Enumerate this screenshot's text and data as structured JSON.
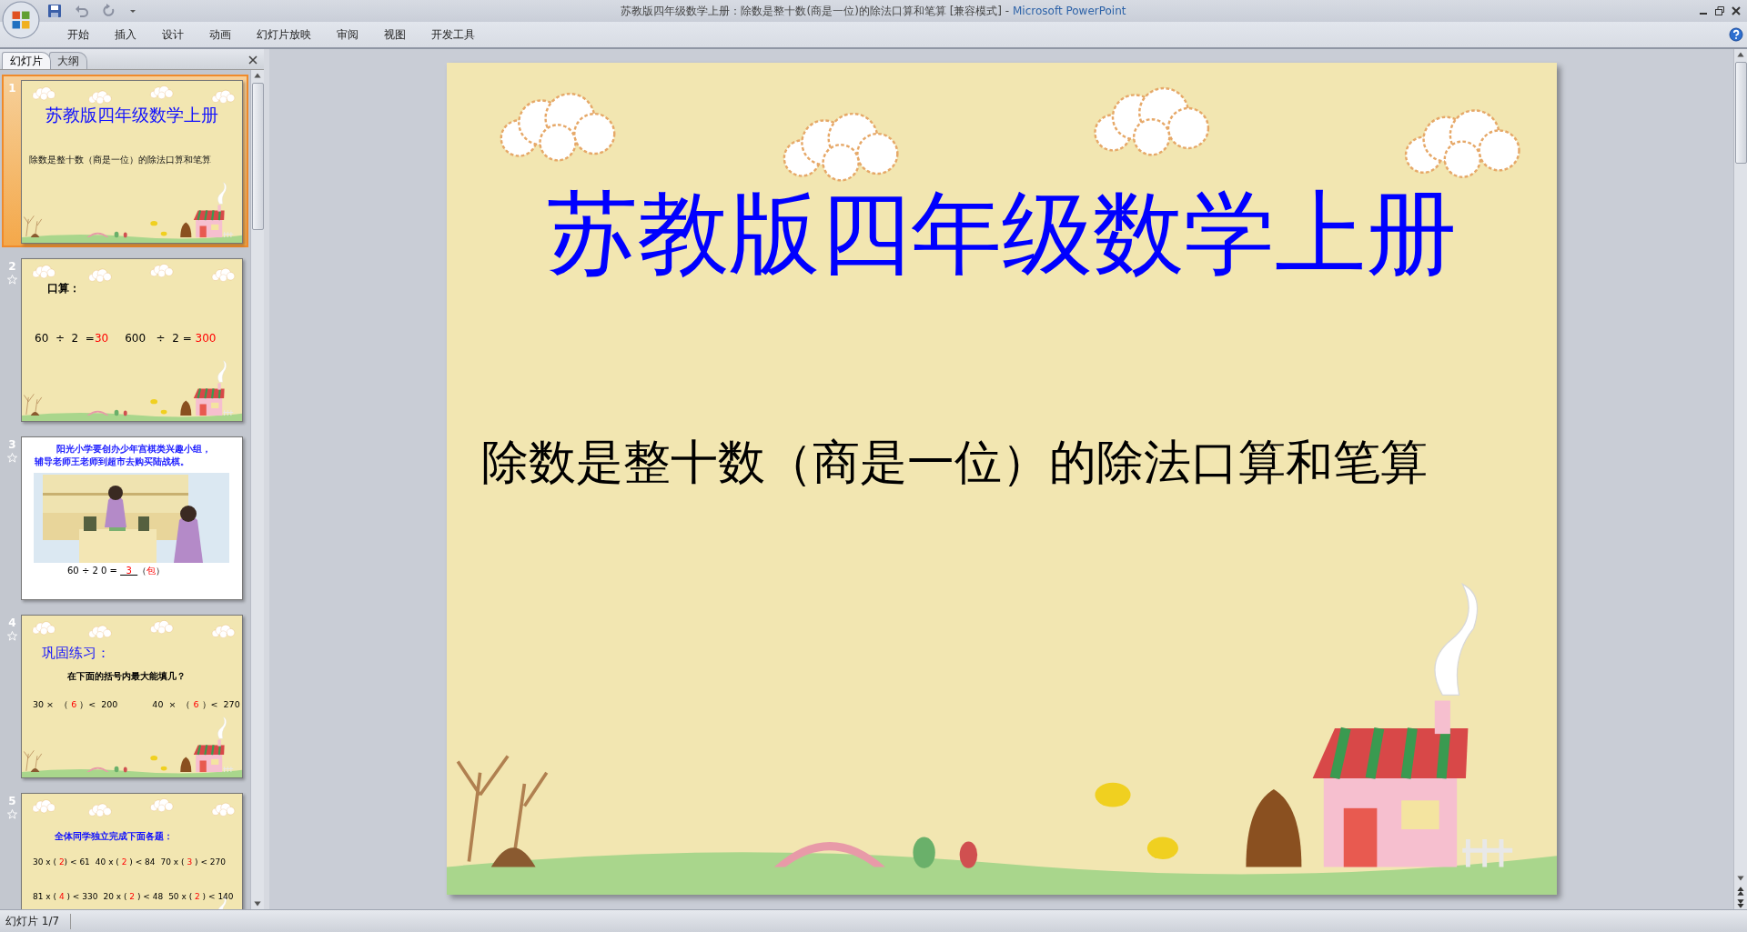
{
  "window": {
    "title": "苏教版四年级数学上册：除数是整十数(商是一位)的除法口算和笔算 [兼容模式]",
    "separator": "-",
    "app": "Microsoft PowerPoint"
  },
  "ribbon_tabs": [
    "开始",
    "插入",
    "设计",
    "动画",
    "幻灯片放映",
    "审阅",
    "视图",
    "开发工具"
  ],
  "panel_tabs": [
    {
      "label": "幻灯片",
      "selected": true
    },
    {
      "label": "大纲",
      "selected": false
    }
  ],
  "thumbnails": [
    {
      "number": "1",
      "selected": true,
      "animated": false,
      "kind": "title",
      "title": "苏教版四年级数学上册",
      "subtitle": "除数是整十数（商是一位）的除法口算和笔算"
    },
    {
      "number": "2",
      "selected": false,
      "animated": true,
      "kind": "mental",
      "heading": "口算：",
      "rows": [
        [
          [
            {
              "text": "60  ÷  2  =",
              "answer": false,
              "underlined": false
            },
            {
              "text": "30",
              "answer": true,
              "underlined": false
            }
          ],
          [
            {
              "text": "600   ÷  2 =",
              "answer": false,
              "underlined": false
            },
            {
              "text": " 300",
              "answer": true,
              "underlined": false
            }
          ]
        ]
      ]
    },
    {
      "number": "3",
      "selected": false,
      "animated": true,
      "kind": "problem",
      "lines": [
        "阳光小学要创办少年宫棋类兴趣小组，",
        "辅导老师王老师到超市去购买陆战棋。"
      ],
      "rows": [
        [
          [
            {
              "text": "60 ÷ 2 0 = ",
              "answer": false,
              "underlined": false
            },
            {
              "text": "  3  ",
              "answer": true,
              "underlined": true
            },
            {
              "text": "（",
              "answer": false,
              "underlined": false
            },
            {
              "text": "包",
              "answer": true,
              "underlined": false
            },
            {
              "text": "）",
              "answer": false,
              "underlined": false
            }
          ]
        ]
      ]
    },
    {
      "number": "4",
      "selected": false,
      "animated": true,
      "kind": "practice",
      "heading": "巩固练习：",
      "question": "在下面的括号内最大能填几？",
      "rows": [
        [
          [
            {
              "text": "30 ×  （ ",
              "answer": false,
              "underlined": false
            },
            {
              "text": "6",
              "answer": true,
              "underlined": false
            },
            {
              "text": " ）<  200",
              "answer": false,
              "underlined": false
            }
          ],
          [
            {
              "text": "40  ×  （ ",
              "answer": false,
              "underlined": false
            },
            {
              "text": "6",
              "answer": true,
              "underlined": false
            },
            {
              "text": " ）<  270",
              "answer": false,
              "underlined": false
            }
          ]
        ]
      ]
    },
    {
      "number": "5",
      "selected": false,
      "animated": true,
      "kind": "exercise",
      "heading": "全体同学独立完成下面各题：",
      "rows": [
        [
          [
            {
              "text": "30 x ( ",
              "answer": false,
              "underlined": false
            },
            {
              "text": "2",
              "answer": true,
              "underlined": false
            },
            {
              "text": ") < 61",
              "answer": false,
              "underlined": false
            }
          ],
          [
            {
              "text": "40 x ( ",
              "answer": false,
              "underlined": false
            },
            {
              "text": "2",
              "answer": true,
              "underlined": false
            },
            {
              "text": " ) < 84",
              "answer": false,
              "underlined": false
            }
          ],
          [
            {
              "text": "70 x ( ",
              "answer": false,
              "underlined": false
            },
            {
              "text": "3",
              "answer": true,
              "underlined": false
            },
            {
              "text": " ) < 270",
              "answer": false,
              "underlined": false
            }
          ]
        ],
        [
          [
            {
              "text": "81 x ( ",
              "answer": false,
              "underlined": false
            },
            {
              "text": "4",
              "answer": true,
              "underlined": false
            },
            {
              "text": " ) < 330",
              "answer": false,
              "underlined": false
            }
          ],
          [
            {
              "text": "20 x ( ",
              "answer": false,
              "underlined": false
            },
            {
              "text": "2",
              "answer": true,
              "underlined": false
            },
            {
              "text": " ) < 48",
              "answer": false,
              "underlined": false
            }
          ],
          [
            {
              "text": "50 x ( ",
              "answer": false,
              "underlined": false
            },
            {
              "text": "2",
              "answer": true,
              "underlined": false
            },
            {
              "text": " ) < 140",
              "answer": false,
              "underlined": false
            }
          ]
        ]
      ]
    }
  ],
  "slide": {
    "title": "苏教版四年级数学上册",
    "subtitle": "除数是整十数（商是一位）的除法口算和笔算"
  },
  "status_bar": {
    "slide_counter": "幻灯片 1/7"
  }
}
